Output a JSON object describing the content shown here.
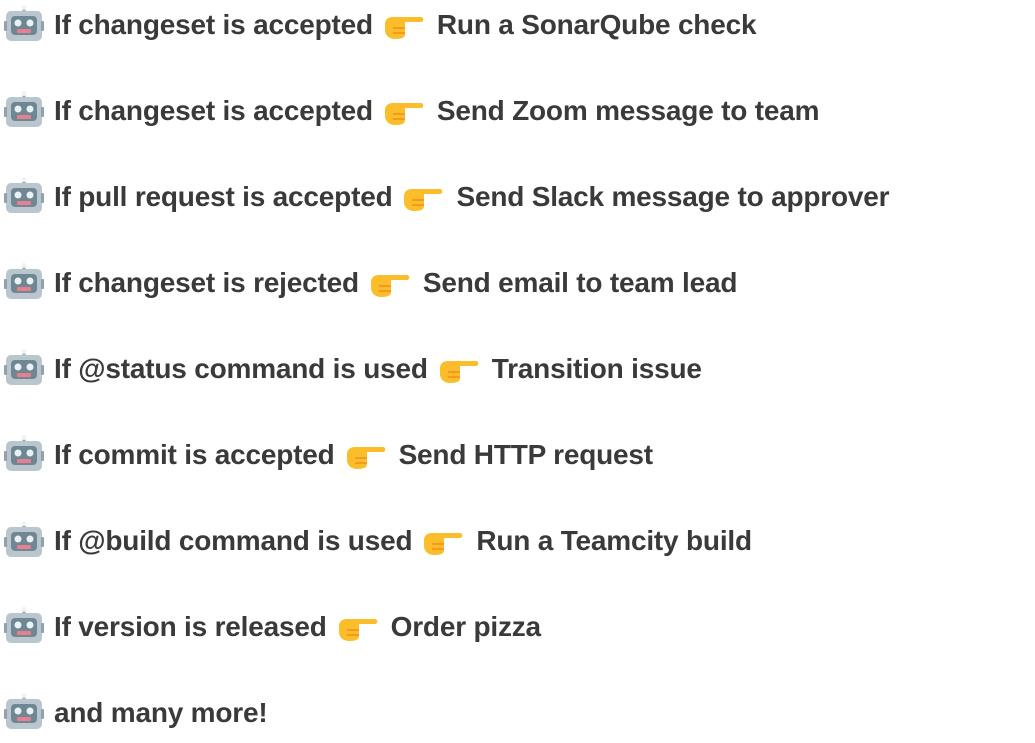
{
  "rules": [
    {
      "trigger": "If changeset is accepted",
      "action": "Run a SonarQube check"
    },
    {
      "trigger": "If changeset is accepted",
      "action": "Send Zoom message to team"
    },
    {
      "trigger": "If pull request is accepted",
      "action": "Send Slack message to approver"
    },
    {
      "trigger": "If changeset is rejected",
      "action": "Send email to team lead"
    },
    {
      "trigger": "If @status command is used",
      "action": "Transition issue"
    },
    {
      "trigger": "If commit is accepted",
      "action": "Send HTTP request"
    },
    {
      "trigger": "If @build command is used",
      "action": "Run a Teamcity build"
    },
    {
      "trigger": "If version is released",
      "action": "Order pizza"
    }
  ],
  "footer": {
    "text": "and many more!"
  },
  "icons": {
    "row_icon": "robot-icon",
    "separator_icon": "pointing-hand-icon"
  },
  "colors": {
    "text": "#3a3a3a",
    "robot_body": "#b9c6cd",
    "robot_face": "#6f8793",
    "robot_mouth": "#e77f8e",
    "hand": "#fbbd2a",
    "hand_shade": "#f39a1f"
  }
}
